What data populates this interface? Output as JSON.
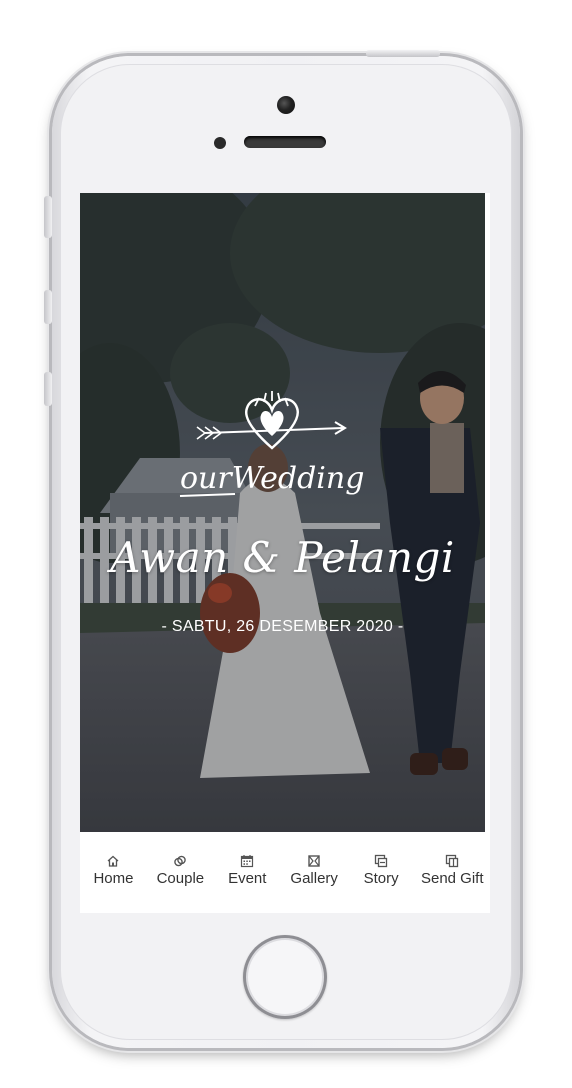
{
  "hero": {
    "logo_text": "ourWedding",
    "couple": "Awan & Pelangi",
    "date": "- SABTU, 26 DESEMBER 2020 -"
  },
  "nav": {
    "items": [
      {
        "label": "Home",
        "icon": "home-icon"
      },
      {
        "label": "Couple",
        "icon": "rings-icon"
      },
      {
        "label": "Event",
        "icon": "calendar-icon"
      },
      {
        "label": "Gallery",
        "icon": "gallery-icon"
      },
      {
        "label": "Story",
        "icon": "story-icon"
      },
      {
        "label": "Send Gift",
        "icon": "gift-icon"
      }
    ]
  },
  "colors": {
    "nav_text": "#333333",
    "hero_text": "#ffffff",
    "phone_body": "#f2f2f4"
  }
}
